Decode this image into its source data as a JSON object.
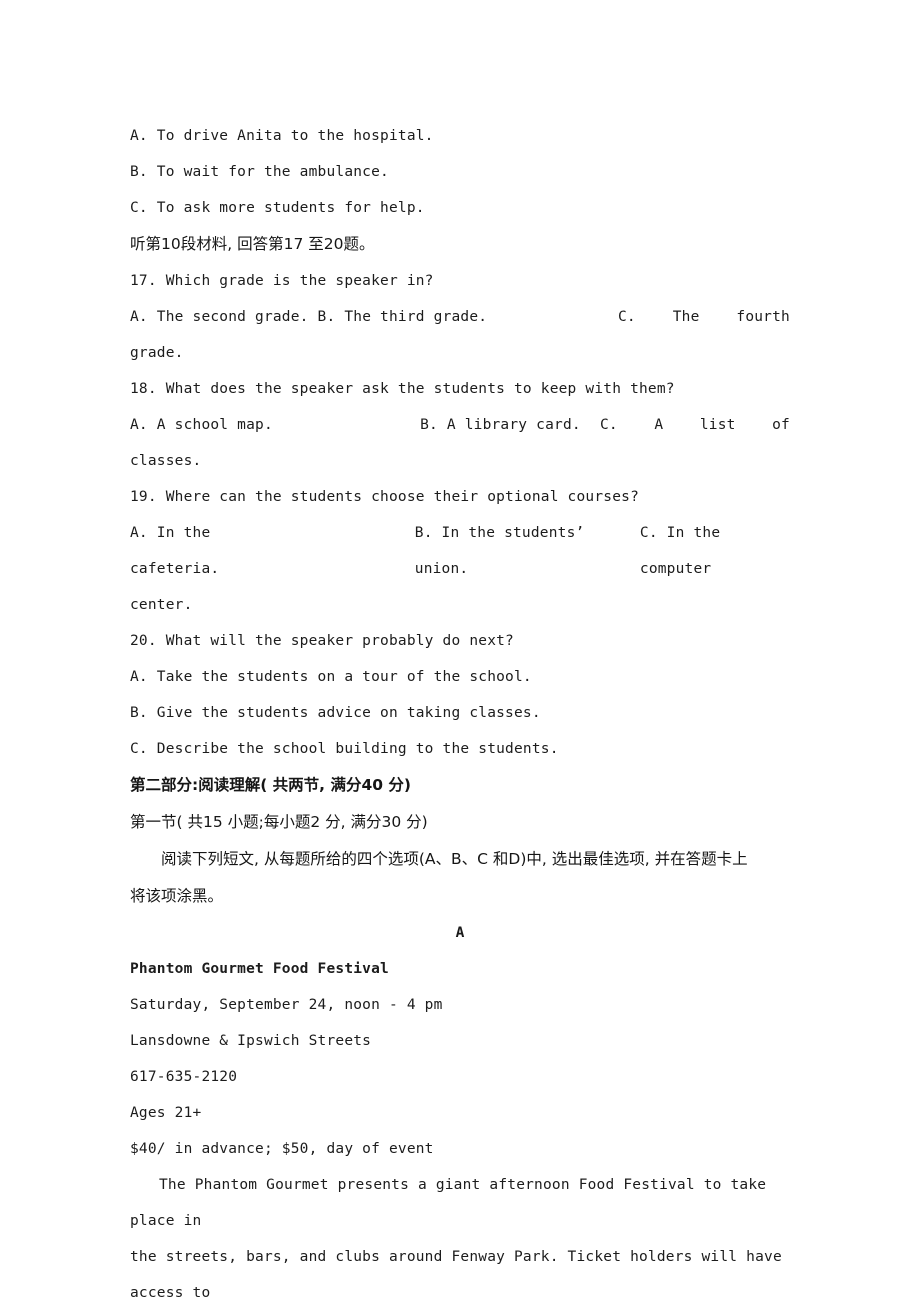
{
  "document": {
    "type": "exam-paper",
    "language": "zh-CN + en"
  },
  "listening": {
    "q16_options": [
      "A. To drive Anita to the hospital.",
      "B. To wait for the ambulance.",
      "C. To ask more students for help."
    ],
    "material_instruction": "听第10段材料, 回答第17 至20题。",
    "questions": [
      {
        "number": "17.",
        "stem": "17. Which grade is the speaker in?",
        "option_a": "A. The second grade.",
        "option_b": "B. The third grade.",
        "option_c_lead": "C.",
        "option_c_mid": "The",
        "option_c_tail": "fourth",
        "option_c_wrap": "grade."
      },
      {
        "number": "18.",
        "stem": "18. What does the speaker ask the students to keep with them?",
        "option_a": "A. A school map.",
        "option_b": "B. A library card.",
        "option_c_lead": "C.",
        "option_c_mid": "A",
        "option_c_mid2": "list",
        "option_c_tail": "of",
        "option_c_wrap": "classes."
      },
      {
        "number": "19.",
        "stem": "19. Where can the students choose their optional courses?",
        "option_a": "A. In the cafeteria.",
        "option_b": "B. In the students’  union.",
        "option_c": "C. In the computer",
        "option_c_wrap": "center."
      },
      {
        "number": "20.",
        "stem": "20. What will the speaker probably do next?",
        "options": [
          "A. Take the students on a tour of the school.",
          "B. Give the students advice on taking classes.",
          "C. Describe the school building to the students."
        ]
      }
    ]
  },
  "reading": {
    "part_heading": "第二部分:阅读理解( 共两节, 满分40 分)",
    "section_heading": "第一节( 共15 小题;每小题2 分, 满分30 分)",
    "instruction_line1": "阅读下列短文, 从每题所给的四个选项(A、B、C 和D)中, 选出最佳选项, 并在答题卡上",
    "instruction_line2": "将该项涂黑。",
    "passage_mark": "A"
  },
  "passage_a": {
    "title": "Phantom Gourmet Food Festival",
    "details": [
      "Saturday, September 24, noon - 4 pm",
      "Lansdowne & Ipswich Streets",
      "617-635-2120",
      "Ages 21+",
      "$40/ in advance; $50, day of event"
    ],
    "body_line1": "The Phantom Gourmet presents a giant afternoon Food Festival to take place in",
    "body_line2": "the streets, bars, and clubs around Fenway Park. Ticket holders will have access to"
  }
}
